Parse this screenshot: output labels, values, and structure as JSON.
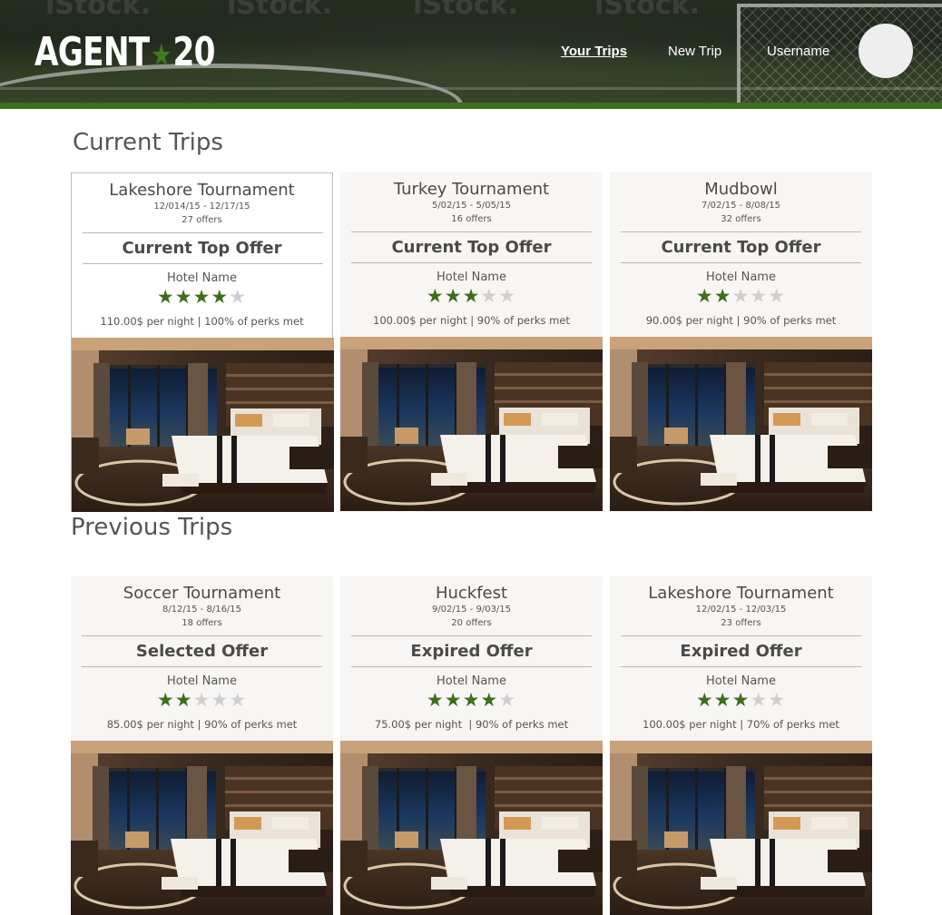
{
  "header": {
    "logo": "AGENT",
    "logo_star": "★",
    "logo_number": "20",
    "nav": {
      "your_trips": "Your Trips",
      "new_trip": "New Trip",
      "username": "Username"
    },
    "watermarks": [
      "iStock.",
      "iStock.",
      "iStock.",
      "iStock."
    ]
  },
  "current_trips": {
    "title": "Current Trips",
    "cards": [
      {
        "name": "Lakeshore Tournament",
        "dates": "12/014/15 - 12/17/15",
        "offers": "27 offers",
        "offer_title": "Current Top Offer",
        "hotel": "Hotel Name",
        "rating": 4,
        "price": "110.00$ per night | 100% of perks met"
      },
      {
        "name": "Turkey Tournament",
        "dates": "5/02/15 - 5/05/15",
        "offers": "16 offers",
        "offer_title": "Current Top Offer",
        "hotel": "Hotel Name",
        "rating": 3,
        "price": "100.00$ per night | 90% of perks met"
      },
      {
        "name": "Mudbowl",
        "dates": "7/02/15 - 8/08/15",
        "offers": "32 offers",
        "offer_title": "Current Top Offer",
        "hotel": "Hotel Name",
        "rating": 2,
        "price": "90.00$ per night | 90% of perks met"
      }
    ]
  },
  "previous_trips": {
    "title": "Previous Trips",
    "cards": [
      {
        "name": "Soccer Tournament",
        "dates": "8/12/15 - 8/16/15",
        "offers": "18 offers",
        "offer_title": "Selected Offer",
        "hotel": "Hotel Name",
        "rating": 2,
        "price": "85.00$ per night | 90% of perks met"
      },
      {
        "name": "Huckfest",
        "dates": "9/02/15 - 9/03/15",
        "offers": "20 offers",
        "offer_title": "Expired Offer",
        "hotel": "Hotel Name",
        "rating": 4,
        "price": "75.00$ per night  | 90% of perks met"
      },
      {
        "name": "Lakeshore Tournament",
        "dates": "12/02/15 - 12/03/15",
        "offers": "23 offers",
        "offer_title": "Expired Offer",
        "hotel": "Hotel Name",
        "rating": 3,
        "price": "100.00$ per night | 70% of perks met"
      }
    ]
  },
  "colors": {
    "brand_green": "#3f6f1a",
    "star_on": "#3f6e1a",
    "star_off": "#cfcfcf",
    "card_bg": "#f7f6f4"
  },
  "icons": {
    "star": "star-icon",
    "avatar": "user-avatar"
  }
}
